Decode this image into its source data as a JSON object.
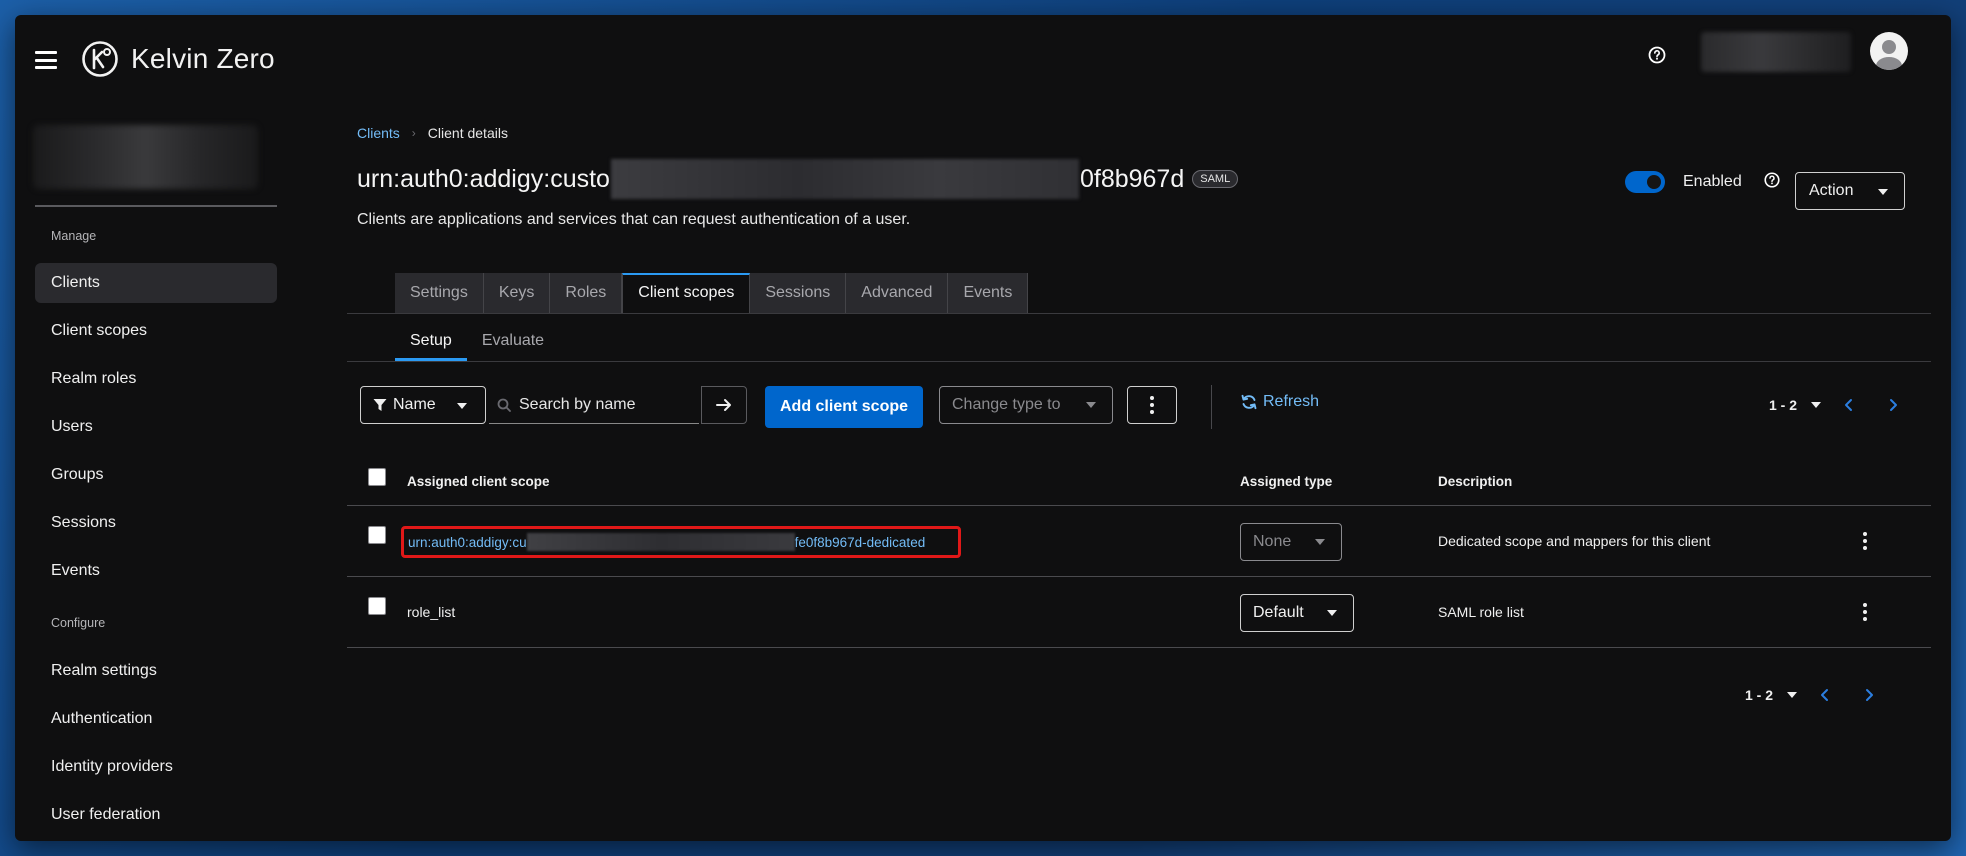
{
  "masthead": {
    "brand_name": "Kelvin Zero",
    "help_icon": "question-circle-icon",
    "avatar_icon": "user-avatar-icon"
  },
  "sidebar": {
    "manage_label": "Manage",
    "manage_items": [
      {
        "label": "Clients",
        "active": true
      },
      {
        "label": "Client scopes"
      },
      {
        "label": "Realm roles"
      },
      {
        "label": "Users"
      },
      {
        "label": "Groups"
      },
      {
        "label": "Sessions"
      },
      {
        "label": "Events"
      }
    ],
    "configure_label": "Configure",
    "configure_items": [
      {
        "label": "Realm settings"
      },
      {
        "label": "Authentication"
      },
      {
        "label": "Identity providers"
      },
      {
        "label": "User federation"
      }
    ]
  },
  "breadcrumb": {
    "parent": "Clients",
    "current": "Client details"
  },
  "header": {
    "title_prefix": "urn:auth0:addigy:custo",
    "title_suffix": "0f8b967d",
    "badge": "SAML",
    "subtitle": "Clients are applications and services that can request authentication of a user.",
    "enabled_label": "Enabled",
    "enabled": true,
    "action_label": "Action"
  },
  "tabs": [
    {
      "label": "Settings"
    },
    {
      "label": "Keys"
    },
    {
      "label": "Roles"
    },
    {
      "label": "Client scopes",
      "active": true
    },
    {
      "label": "Sessions"
    },
    {
      "label": "Advanced"
    },
    {
      "label": "Events"
    }
  ],
  "subtabs": [
    {
      "label": "Setup",
      "active": true
    },
    {
      "label": "Evaluate"
    }
  ],
  "toolbar": {
    "filter_label": "Name",
    "search_placeholder": "Search by name",
    "add_label": "Add client scope",
    "change_type_placeholder": "Change type to",
    "refresh_label": "Refresh",
    "pagination_top": "1 - 2",
    "pagination_bottom": "1 - 2"
  },
  "table": {
    "columns": [
      "Assigned client scope",
      "Assigned type",
      "Description"
    ],
    "rows": [
      {
        "name_prefix": "urn:auth0:addigy:cu",
        "name_suffix": "fe0f8b967d-dedicated",
        "type": "None",
        "description": "Dedicated scope and mappers for this client"
      },
      {
        "name": "role_list",
        "type": "Default",
        "description": "SAML role list"
      }
    ]
  },
  "colors": {
    "accent": "#0066cc",
    "link": "#73bcf7",
    "highlight": "#e01818"
  }
}
